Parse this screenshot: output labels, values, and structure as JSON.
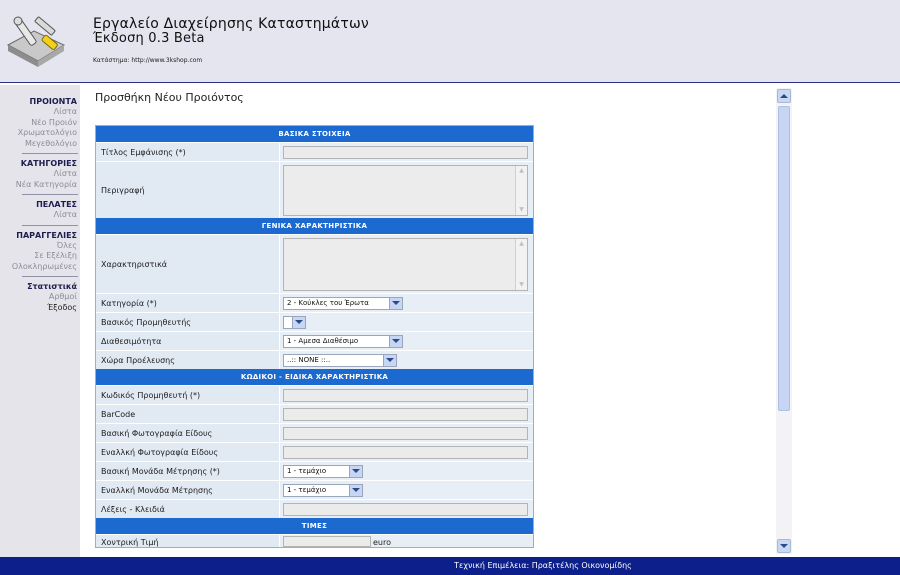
{
  "header": {
    "title": "Εργαλείο Διαχείρησης Καταστημάτων",
    "version": "Έκδοση 0.3 Beta",
    "store_line": "Κατάστημα: http://www.3kshop.com",
    "logo_icon": "tools-logo-icon"
  },
  "sidebar": {
    "groups": [
      {
        "title": "ΠΡΟΙΟΝΤΑ",
        "items": [
          "Λίστα",
          "Νέο Προιόν",
          "Χρωματολόγιο",
          "Μεγεθολόγιο"
        ]
      },
      {
        "title": "ΚΑΤΗΓΟΡΙΕΣ",
        "items": [
          "Λίστα",
          "Νέα Κατηγορία"
        ]
      },
      {
        "title": "ΠΕΛΑΤΕΣ",
        "items": [
          "Λίστα"
        ]
      },
      {
        "title": "ΠΑΡΑΓΓΕΛΙΕΣ",
        "items": [
          "Όλες",
          "Σε Εξέλιξη",
          "Ολοκληρωμένες"
        ]
      },
      {
        "title": "Στατιστικά",
        "items": [
          "Αρθμοί",
          "Έξοδος"
        ]
      }
    ]
  },
  "main": {
    "page_title": "Προσθήκη Νέου Προιόντος",
    "sections": {
      "basic": "ΒΑΣΙΚΑ ΣΤΟΙΧΕΙΑ",
      "general": "ΓΕΝΙΚΑ ΧΑΡΑΚΤΗΡΙΣΤΙΚΑ",
      "codes": "ΚΩΔΙΚΟΙ - ΕΙΔΙΚΑ ΧΑΡΑΚΤΗΡΙΣΤΙΚΑ",
      "prices": "ΤΙΜΕΣ"
    },
    "fields": {
      "title_label": "Τίτλος Εμφάνισης (*)",
      "description_label": "Περιγραφή",
      "features_label": "Χαρακτηριστικά",
      "category_label": "Κατηγορία (*)",
      "category_value": "2 - Κούκλες του Έρωτα",
      "supplier_label": "Βασικός Προμηθευτής",
      "supplier_value": "",
      "availability_label": "Διαθεσιμότητα",
      "availability_value": "1 - Αμεσα Διαθέσιμο",
      "origin_label": "Χώρα Προέλευσης",
      "origin_value": "..:: NONE ::..",
      "supplier_code_label": "Κωδικός Προμηθευτή (*)",
      "barcode_label": "BarCode",
      "main_photo_label": "Βασική Φωτογραφία Είδους",
      "alt_photo_label": "Εναλλκή Φωτογραφία Είδους",
      "main_unit_label": "Βασική Μονάδα Μέτρησης (*)",
      "main_unit_value": "1 - τεμάχιο",
      "alt_unit_label": "Εναλλκή Μονάδα Μέτρησης",
      "alt_unit_value": "1 - τεμάχιο",
      "keywords_label": "Λέξεις - Κλειδιά",
      "wholesale_label": "Χοντρική Τιμή",
      "currency": "euro"
    }
  },
  "footer": {
    "text": "Τεχνική Επιμέλεια: Πραξιτέλης Οικονομίδης"
  }
}
